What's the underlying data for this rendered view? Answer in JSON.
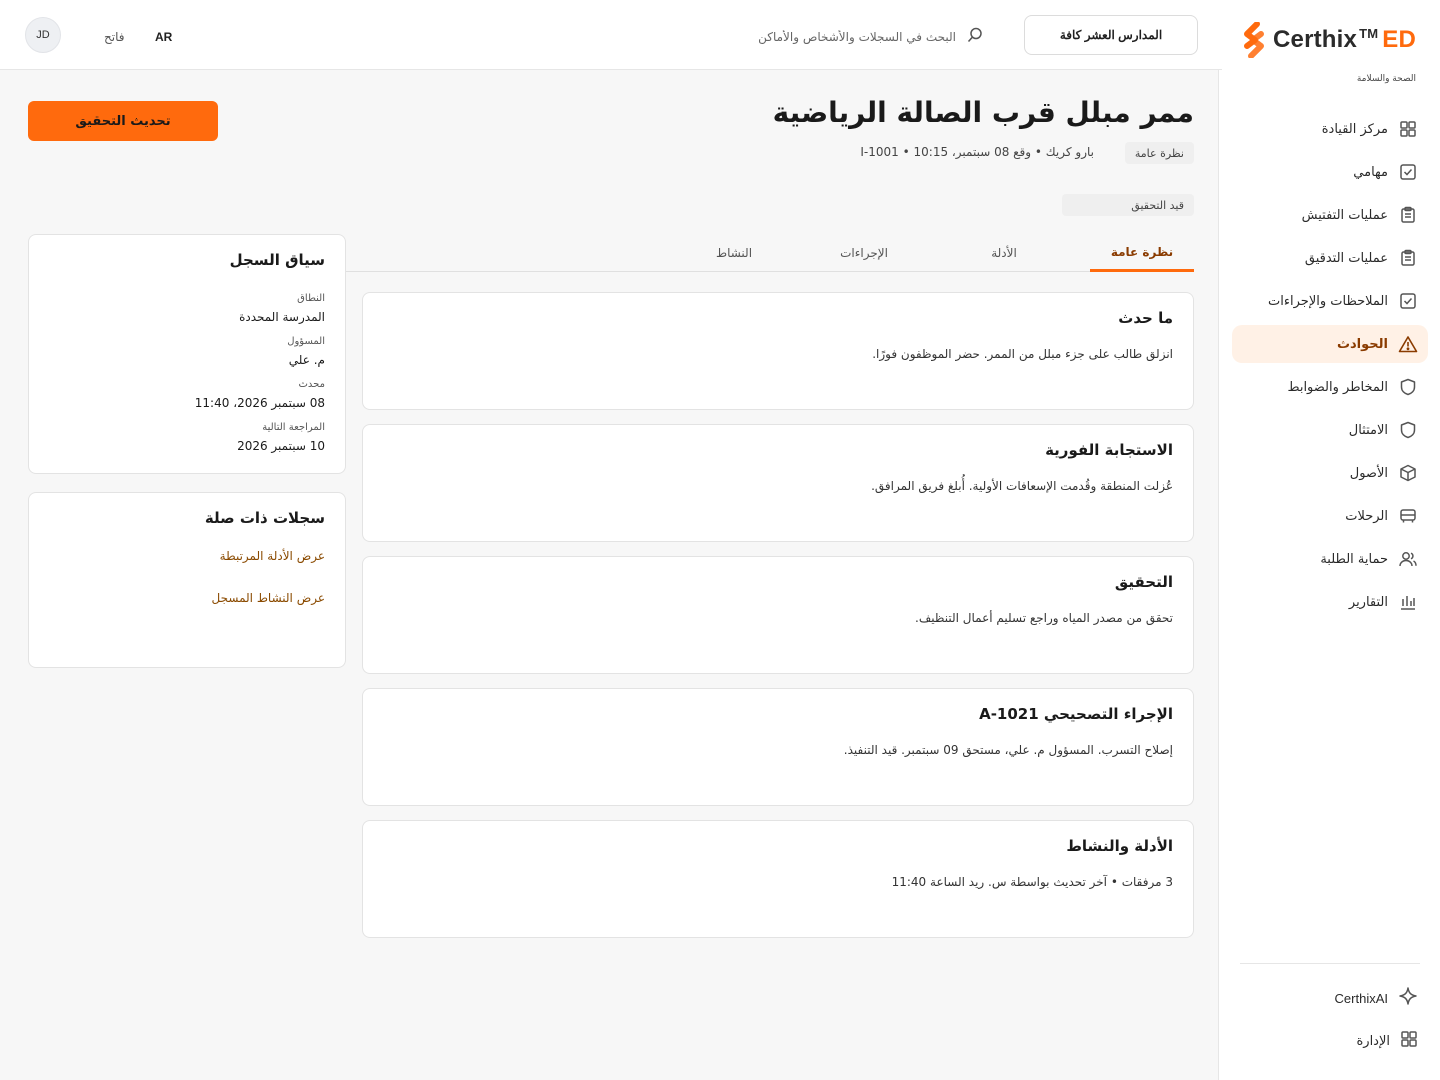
{
  "brand": {
    "name": "Certhix",
    "tm": "TM",
    "suffix": "ED",
    "subtitle": "الصحة والسلامة",
    "accent": "#ff6a0d"
  },
  "topbar": {
    "scope_label": "المدارس العشر كافة",
    "search_placeholder": "البحث في السجلات والأشخاص والأماكن",
    "language": "AR",
    "theme_label": "فاتح",
    "avatar_initials": "JD"
  },
  "sidebar": {
    "items": [
      {
        "label": "مركز القيادة",
        "icon": "grid-icon"
      },
      {
        "label": "مهامي",
        "icon": "check-square-icon"
      },
      {
        "label": "عمليات التفتيش",
        "icon": "clipboard-icon"
      },
      {
        "label": "عمليات التدقيق",
        "icon": "clipboard-icon"
      },
      {
        "label": "الملاحظات والإجراءات",
        "icon": "check-square-icon"
      },
      {
        "label": "الحوادث",
        "icon": "warning-icon",
        "active": true
      },
      {
        "label": "المخاطر والضوابط",
        "icon": "shield-icon"
      },
      {
        "label": "الامتثال",
        "icon": "shield-icon"
      },
      {
        "label": "الأصول",
        "icon": "box-icon"
      },
      {
        "label": "الرحلات",
        "icon": "bus-icon"
      },
      {
        "label": "حماية الطلبة",
        "icon": "users-icon"
      },
      {
        "label": "التقارير",
        "icon": "bar-chart-icon"
      }
    ],
    "ai_label": "CerthixAI",
    "admin_label": "الإدارة"
  },
  "header": {
    "title": "ممر مبلل قرب الصالة الرياضية",
    "overview_chip": "نظرة عامة",
    "meta": "بارو كريك • وقع 08 سبتمبر، 10:15 • I-1001",
    "status": "قيد التحقيق",
    "primary_action": "تحديث التحقيق"
  },
  "tabs": [
    "نظرة عامة",
    "الأدلة",
    "الإجراءات",
    "النشاط"
  ],
  "cards": [
    {
      "title": "ما حدث",
      "body": "انزلق طالب على جزء مبلل من الممر. حضر الموظفون فورًا."
    },
    {
      "title": "الاستجابة الفورية",
      "body": "عُزلت المنطقة وقُدمت الإسعافات الأولية. أُبلغ فريق المرافق."
    },
    {
      "title": "التحقيق",
      "body": "تحقق من مصدر المياه وراجع تسليم أعمال التنظيف."
    },
    {
      "title": "الإجراء التصحيحي A-1021",
      "body": "إصلاح التسرب. المسؤول م. علي، مستحق 09 سبتمبر. قيد التنفيذ."
    },
    {
      "title": "الأدلة والنشاط",
      "body": "3 مرفقات • آخر تحديث بواسطة س. ريد الساعة 11:40"
    }
  ],
  "context": {
    "title": "سياق السجل",
    "fields": [
      {
        "label": "النطاق",
        "value": "المدرسة المحددة"
      },
      {
        "label": "المسؤول",
        "value": "م. علي"
      },
      {
        "label": "محدث",
        "value": "08 سبتمبر 2026، 11:40"
      },
      {
        "label": "المراجعة التالية",
        "value": "10 سبتمبر 2026"
      }
    ]
  },
  "related": {
    "title": "سجلات ذات صلة",
    "links": [
      "عرض الأدلة المرتبطة",
      "عرض النشاط المسجل"
    ]
  }
}
